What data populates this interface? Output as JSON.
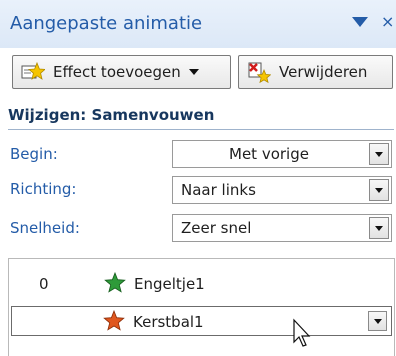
{
  "pane": {
    "title": "Aangepaste animatie",
    "menu_icon": "dropdown-arrow-icon",
    "close_icon": "close-icon"
  },
  "toolbar": {
    "effect_label": "Effect toevoegen",
    "effect_icon": "add-effect-star-icon",
    "remove_label": "Verwijderen",
    "remove_icon": "remove-effect-icon"
  },
  "section": {
    "title": "Wijzigen: Samenvouwen"
  },
  "properties": [
    {
      "label": "Begin:",
      "value": "Met vorige"
    },
    {
      "label": "Richting:",
      "value": "Naar links"
    },
    {
      "label": "Snelheid:",
      "value": "Zeer snel"
    }
  ],
  "animations": [
    {
      "order": "0",
      "name": "Engeltje1",
      "star_color": "#2e9b3a"
    },
    {
      "order": "",
      "name": "Kerstbal1",
      "star_color": "#e0571f"
    }
  ],
  "colors": {
    "accent": "#245ca8",
    "section_title": "#17375e"
  }
}
